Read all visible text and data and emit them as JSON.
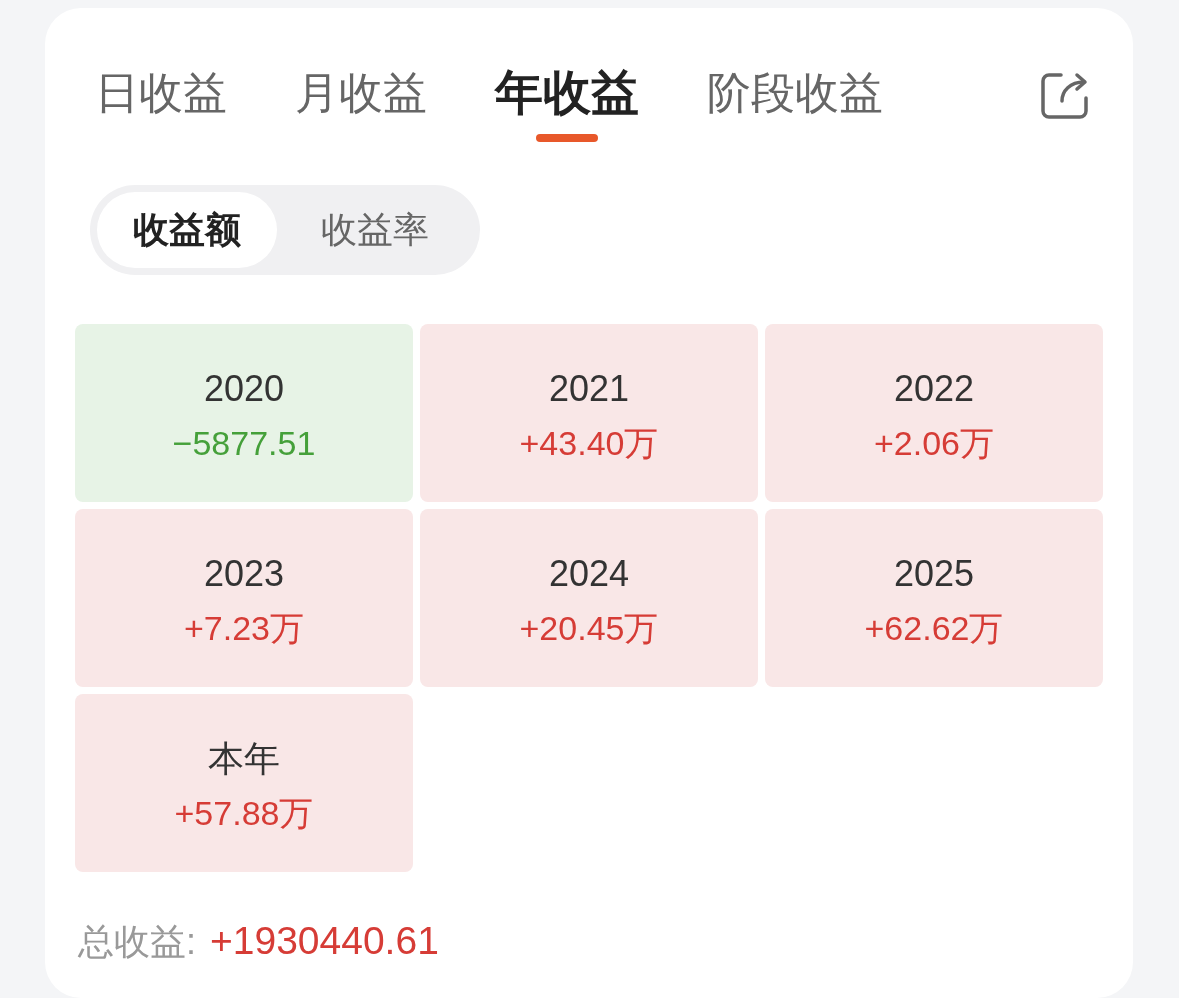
{
  "tabs": [
    {
      "label": "日收益",
      "selected": false
    },
    {
      "label": "月收益",
      "selected": false
    },
    {
      "label": "年收益",
      "selected": true
    },
    {
      "label": "阶段收益",
      "selected": false
    }
  ],
  "metric_toggle": [
    {
      "label": "收益额",
      "selected": true
    },
    {
      "label": "收益率",
      "selected": false
    }
  ],
  "year_tiles": [
    {
      "kind": "loss",
      "year": "2020",
      "value": "−5877.51"
    },
    {
      "kind": "gain",
      "year": "2021",
      "value": "+43.40万"
    },
    {
      "kind": "gain",
      "year": "2022",
      "value": "+2.06万"
    },
    {
      "kind": "gain",
      "year": "2023",
      "value": "+7.23万"
    },
    {
      "kind": "gain",
      "year": "2024",
      "value": "+20.45万"
    },
    {
      "kind": "gain",
      "year": "2025",
      "value": "+62.62万"
    },
    {
      "kind": "gain",
      "year": "本年",
      "value": "+57.88万"
    }
  ],
  "total": {
    "label": "总收益:",
    "value": "+1930440.61"
  }
}
